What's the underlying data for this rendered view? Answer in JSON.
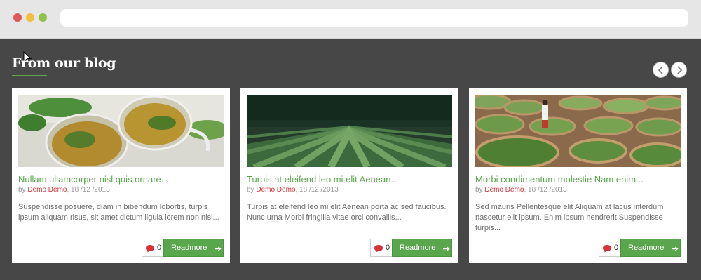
{
  "section": {
    "title": "From our blog"
  },
  "posts": [
    {
      "title": "Nullam ullamcorper nisl quis ornare...",
      "by_label": "by",
      "author": "Demo Demo",
      "date": ", 18 /12 /2013",
      "excerpt": "Suspendisse posuere, diam in bibendum lobortis, turpis ipsum aliquam risus, sit amet dictum ligula lorem non nisl...",
      "comment_count": "0",
      "readmore_label": "Readmore",
      "image": "tea-cups-with-mint"
    },
    {
      "title": "Turpis at eleifend leo mi elit Aenean...",
      "by_label": "by",
      "author": "Demo Demo",
      "date": ", 18 /12 /2013",
      "excerpt": "Turpis at eleifend leo mi elit Aenean porta ac sed faucibus. Nunc urna Morbi fringilla vitae orci convallis...",
      "comment_count": "0",
      "readmore_label": "Readmore",
      "image": "tea-plantation-rows"
    },
    {
      "title": "Morbi condimentum molestie Nam enim...",
      "by_label": "by",
      "author": "Demo Demo",
      "date": ", 18 /12 /2013",
      "excerpt": "Sed mauris Pellentesque elit Aliquam at lacus interdum nascetur elit ipsum. Enim ipsum hendrerit Suspendisse turpis...",
      "comment_count": "0",
      "readmore_label": "Readmore",
      "image": "tea-leaves-drying-baskets"
    }
  ],
  "icons": {
    "prev": "chevron-left-icon",
    "next": "chevron-right-icon",
    "comment": "speech-bubble-icon",
    "arrow": "arrow-right-icon"
  },
  "colors": {
    "accent_green": "#5aa64c",
    "author_red": "#d6323a",
    "background": "#474747"
  }
}
